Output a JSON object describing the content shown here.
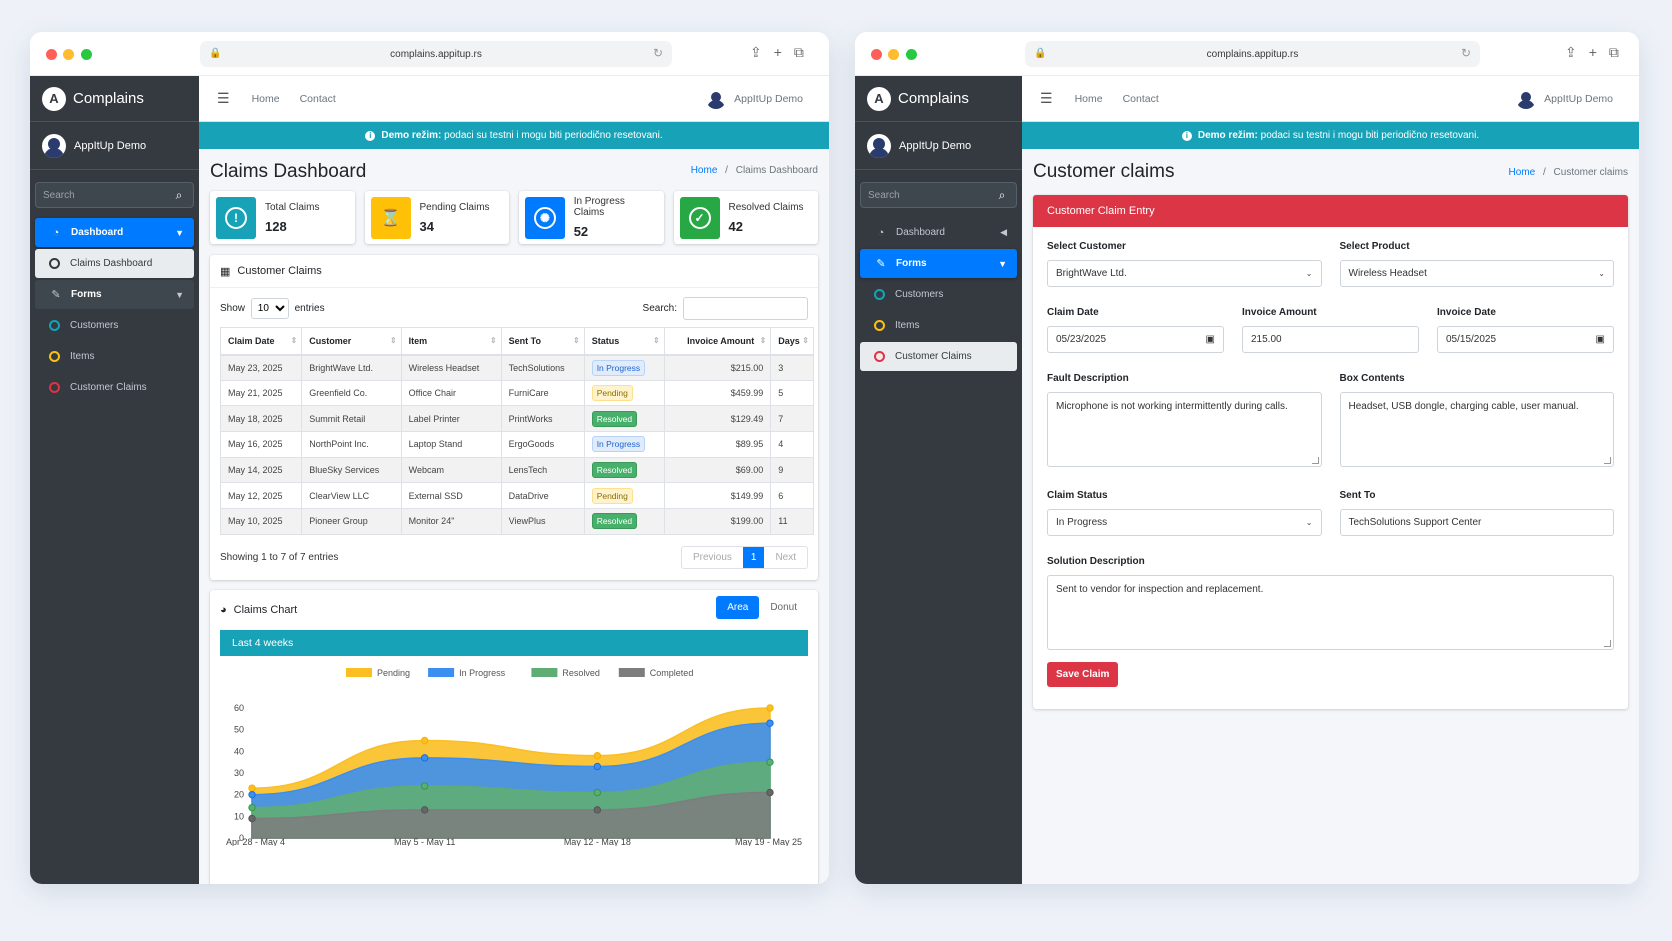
{
  "browser": {
    "url": "complains.appitup.rs"
  },
  "app": {
    "brand": "Complains",
    "brand_logo": "A",
    "user": "AppItUp Demo",
    "search_placeholder": "Search",
    "topnav": {
      "home": "Home",
      "contact": "Contact",
      "user": "AppItUp Demo"
    },
    "demo_notice_bold": "Demo režim:",
    "demo_notice_text": " podaci su testni i mogu biti periodično resetovani."
  },
  "left": {
    "sidebar": {
      "dashboard": "Dashboard",
      "claims_dashboard": "Claims Dashboard",
      "forms": "Forms",
      "customers": "Customers",
      "items": "Items",
      "customer_claims": "Customer Claims"
    },
    "title": "Claims Dashboard",
    "breadcrumb": {
      "home": "Home",
      "sep": "/",
      "current": "Claims Dashboard"
    },
    "info_boxes": [
      {
        "label": "Total Claims",
        "value": "128",
        "color": "#17a2b8",
        "icon": "exclamation-icon"
      },
      {
        "label": "Pending Claims",
        "value": "34",
        "color": "#ffc107",
        "icon": "hourglass-icon"
      },
      {
        "label": "In Progress Claims",
        "value": "52",
        "color": "#007bff",
        "icon": "spinner-icon"
      },
      {
        "label": "Resolved Claims",
        "value": "42",
        "color": "#28a745",
        "icon": "check-icon"
      }
    ],
    "table_card": {
      "title": "Customer Claims",
      "show": "Show",
      "entries_value": "10",
      "entries": "entries",
      "search": "Search:",
      "columns": [
        "Claim Date",
        "Customer",
        "Item",
        "Sent To",
        "Status",
        "Invoice Amount",
        "Days"
      ],
      "rows": [
        [
          "May 23, 2025",
          "BrightWave Ltd.",
          "Wireless Headset",
          "TechSolutions",
          "In Progress",
          "$215.00",
          "3"
        ],
        [
          "May 21, 2025",
          "Greenfield Co.",
          "Office Chair",
          "FurniCare",
          "Pending",
          "$459.99",
          "5"
        ],
        [
          "May 18, 2025",
          "Summit Retail",
          "Label Printer",
          "PrintWorks",
          "Resolved",
          "$129.49",
          "7"
        ],
        [
          "May 16, 2025",
          "NorthPoint Inc.",
          "Laptop Stand",
          "ErgoGoods",
          "In Progress",
          "$89.95",
          "4"
        ],
        [
          "May 14, 2025",
          "BlueSky Services",
          "Webcam",
          "LensTech",
          "Resolved",
          "$69.00",
          "9"
        ],
        [
          "May 12, 2025",
          "ClearView LLC",
          "External SSD",
          "DataDrive",
          "Pending",
          "$149.99",
          "6"
        ],
        [
          "May 10, 2025",
          "Pioneer Group",
          "Monitor 24\"",
          "ViewPlus",
          "Resolved",
          "$199.00",
          "11"
        ]
      ],
      "showing": "Showing 1 to 7 of 7 entries",
      "prev": "Previous",
      "page": "1",
      "next": "Next"
    },
    "chart_card": {
      "title": "Claims Chart",
      "tab_area": "Area",
      "tab_donut": "Donut",
      "banner": "Last 4 weeks"
    }
  },
  "chart_data": {
    "type": "area",
    "stacked": true,
    "categories": [
      "Apr 28 - May 4",
      "May 5 - May 11",
      "May 12 - May 18",
      "May 19 - May 25"
    ],
    "series": [
      {
        "name": "Pending",
        "color": "#fbbf24",
        "values": [
          3,
          8,
          5,
          7
        ]
      },
      {
        "name": "In Progress",
        "color": "#3b8ff0",
        "values": [
          6,
          13,
          12,
          18
        ]
      },
      {
        "name": "Resolved",
        "color": "#5fad74",
        "values": [
          5,
          11,
          8,
          14
        ]
      },
      {
        "name": "Completed",
        "color": "#7d7d7d",
        "values": [
          9,
          13,
          13,
          21
        ]
      }
    ],
    "ylim": [
      0,
      60
    ],
    "yticks": [
      "0",
      "10",
      "20",
      "30",
      "40",
      "50",
      "60"
    ],
    "legend": "top",
    "grid": false
  },
  "right": {
    "sidebar": {
      "dashboard": "Dashboard",
      "forms": "Forms",
      "customers": "Customers",
      "items": "Items",
      "customer_claims": "Customer Claims"
    },
    "title": "Customer claims",
    "breadcrumb": {
      "home": "Home",
      "sep": "/",
      "current": "Customer claims"
    },
    "form": {
      "header": "Customer Claim Entry",
      "select_customer_label": "Select Customer",
      "select_customer_value": "BrightWave Ltd.",
      "select_product_label": "Select Product",
      "select_product_value": "Wireless Headset",
      "claim_date_label": "Claim Date",
      "claim_date_value": "05/23/2025",
      "invoice_amount_label": "Invoice Amount",
      "invoice_amount_value": "215.00",
      "invoice_date_label": "Invoice Date",
      "invoice_date_value": "05/15/2025",
      "fault_label": "Fault Description",
      "fault_value": "Microphone is not working intermittently during calls.",
      "box_label": "Box Contents",
      "box_value": "Headset, USB dongle, charging cable, user manual.",
      "status_label": "Claim Status",
      "status_value": "In Progress",
      "sent_to_label": "Sent To",
      "sent_to_value": "TechSolutions Support Center",
      "solution_label": "Solution Description",
      "solution_value": "Sent to vendor for inspection and replacement.",
      "save": "Save Claim"
    }
  }
}
